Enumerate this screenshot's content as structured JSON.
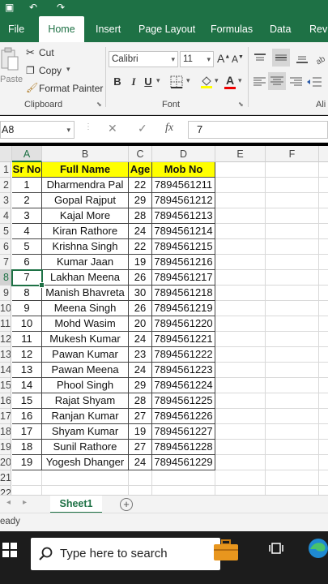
{
  "ribbon_tabs": [
    "File",
    "Home",
    "Insert",
    "Page Layout",
    "Formulas",
    "Data",
    "Revi"
  ],
  "clipboard": {
    "paste_label": "Paste",
    "cut_label": "Cut",
    "copy_label": "Copy",
    "format_painter_label": "Format Painter",
    "group_label": "Clipboard"
  },
  "font": {
    "family": "Calibri",
    "size": "11",
    "bold": "B",
    "italic": "I",
    "underline": "U",
    "group_label": "Font"
  },
  "alignment": {
    "group_label": "Ali"
  },
  "formula_bar": {
    "name_box": "A8",
    "fx": "fx",
    "value": "7"
  },
  "columns": [
    "A",
    "B",
    "C",
    "D",
    "E",
    "F"
  ],
  "row_numbers": [
    "1",
    "2",
    "3",
    "4",
    "5",
    "6",
    "7",
    "8",
    "9",
    "10",
    "11",
    "12",
    "13",
    "14",
    "15",
    "16",
    "17",
    "18",
    "19",
    "20",
    "21",
    "22"
  ],
  "table": {
    "headers": [
      "Sr No",
      "Full Name",
      "Age",
      "Mob No"
    ],
    "rows": [
      [
        "1",
        "Dharmendra Pal",
        "22",
        "7894561211"
      ],
      [
        "2",
        "Gopal Rajput",
        "29",
        "7894561212"
      ],
      [
        "3",
        "Kajal More",
        "28",
        "7894561213"
      ],
      [
        "4",
        "Kiran Rathore",
        "24",
        "7894561214"
      ],
      [
        "5",
        "Krishna Singh",
        "22",
        "7894561215"
      ],
      [
        "6",
        "Kumar Jaan",
        "19",
        "7894561216"
      ],
      [
        "7",
        "Lakhan Meena",
        "26",
        "7894561217"
      ],
      [
        "8",
        "Manish Bhavreta",
        "30",
        "7894561218"
      ],
      [
        "9",
        "Meena Singh",
        "26",
        "7894561219"
      ],
      [
        "10",
        "Mohd Wasim",
        "20",
        "7894561220"
      ],
      [
        "11",
        "Mukesh Kumar",
        "24",
        "7894561221"
      ],
      [
        "12",
        "Pawan Kumar",
        "23",
        "7894561222"
      ],
      [
        "13",
        "Pawan Meena",
        "24",
        "7894561223"
      ],
      [
        "14",
        "Phool Singh",
        "29",
        "7894561224"
      ],
      [
        "15",
        "Rajat Shyam",
        "28",
        "7894561225"
      ],
      [
        "16",
        "Ranjan Kumar",
        "27",
        "7894561226"
      ],
      [
        "17",
        "Shyam Kumar",
        "19",
        "7894561227"
      ],
      [
        "18",
        "Sunil Rathore",
        "27",
        "7894561228"
      ],
      [
        "19",
        "Yogesh Dhanger",
        "24",
        "7894561229"
      ]
    ]
  },
  "sheet_tab": "Sheet1",
  "status": "eady",
  "taskbar": {
    "search_placeholder": "Type here to search"
  },
  "colors": {
    "accent": "#1e7145",
    "header_fill": "#ffff00"
  },
  "icons": [
    "save-icon",
    "undo-icon",
    "redo-icon",
    "scissors-icon",
    "copy-icon",
    "paintbrush-icon",
    "windows-icon",
    "search-icon",
    "briefcase-icon",
    "task-view-icon",
    "edge-icon"
  ]
}
